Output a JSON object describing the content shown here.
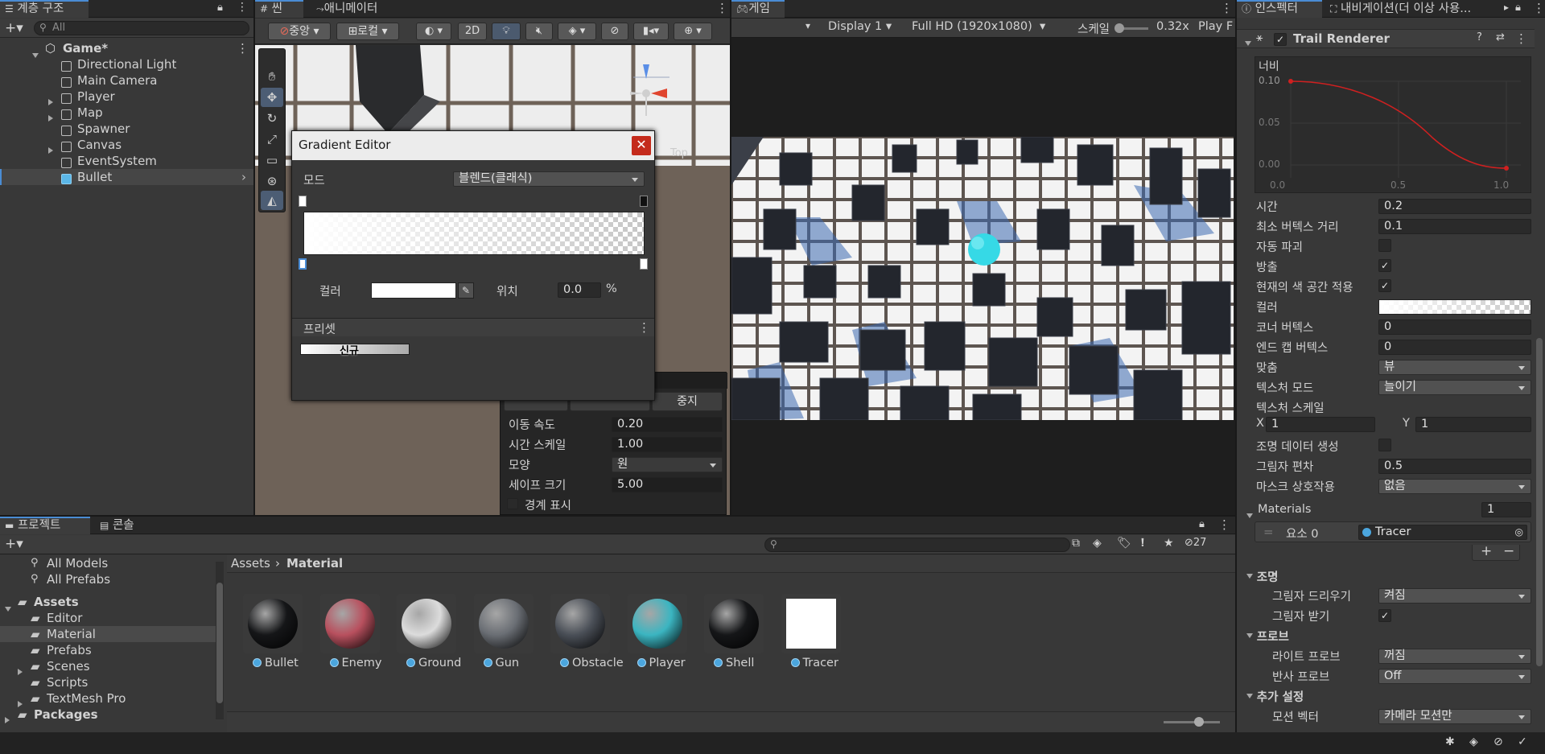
{
  "hierarchy": {
    "tab": "계층 구조",
    "search_placeholder": "All",
    "scene": "Game*",
    "items": [
      "Directional Light",
      "Main Camera",
      "Player",
      "Map",
      "Spawner",
      "Canvas",
      "EventSystem",
      "Bullet"
    ]
  },
  "scene_tabs": {
    "scene": "씬",
    "animator": "애니메이터",
    "pivot": "중앙",
    "space": "로컬",
    "mode2d": "2D",
    "gizmo_top": "Top"
  },
  "game_view": {
    "tab": "게임",
    "display": "Display 1",
    "resolution": "Full HD (1920x1080)",
    "scale_label": "스케일",
    "scale_value": "0.32x",
    "play": "Play F"
  },
  "gradient_editor": {
    "title": "Gradient Editor",
    "mode_label": "모드",
    "mode_value": "블렌드(클래식)",
    "color_label": "컬러",
    "location_label": "위치",
    "location_value": "0.0",
    "percent": "%",
    "presets_label": "프리셋",
    "new_label": "신규"
  },
  "overlay": {
    "stop": "중지",
    "rows": [
      {
        "label": "이동 속도",
        "value": "0.20"
      },
      {
        "label": "시간 스케일",
        "value": "1.00"
      },
      {
        "label": "모양",
        "value": "원"
      },
      {
        "label": "세이프 크기",
        "value": "5.00"
      }
    ],
    "bounds": "경계 표시"
  },
  "inspector": {
    "tab1": "인스펙터",
    "tab2": "내비게이션(더 이상 사용...",
    "component": "Trail Renderer",
    "curve": {
      "label": "너비",
      "y_labels": [
        "0.10",
        "0.05",
        "0.00"
      ],
      "x_labels": [
        "0.0",
        "0.5",
        "1.0"
      ]
    },
    "props": [
      {
        "label": "시간",
        "type": "field",
        "value": "0.2"
      },
      {
        "label": "최소 버텍스 거리",
        "type": "field",
        "value": "0.1"
      },
      {
        "label": "자동 파괴",
        "type": "check",
        "value": ""
      },
      {
        "label": "방출",
        "type": "check",
        "value": "✓"
      },
      {
        "label": "현재의 색 공간 적용",
        "type": "check",
        "value": "✓"
      },
      {
        "label": "컬러",
        "type": "gradient",
        "value": ""
      },
      {
        "label": "코너 버텍스",
        "type": "field",
        "value": "0"
      },
      {
        "label": "엔드 캡 버텍스",
        "type": "field",
        "value": "0"
      },
      {
        "label": "맞춤",
        "type": "drop",
        "value": "뷰"
      },
      {
        "label": "텍스처 모드",
        "type": "drop",
        "value": "늘이기"
      },
      {
        "label": "텍스처 스케일",
        "type": "none",
        "value": ""
      }
    ],
    "tex_x": "1",
    "tex_y": "1",
    "props2": [
      {
        "label": "조명 데이터 생성",
        "type": "check",
        "value": ""
      },
      {
        "label": "그림자 편차",
        "type": "field",
        "value": "0.5"
      },
      {
        "label": "마스크 상호작용",
        "type": "drop",
        "value": "없음"
      }
    ],
    "materials_label": "Materials",
    "materials_count": "1",
    "element_label": "요소 0",
    "element_value": "Tracer",
    "lighting_header": "조명",
    "cast_shadows": "그림자 드리우기",
    "cast_value": "켜짐",
    "receive_shadows": "그림자 받기",
    "probes_header": "프로브",
    "light_probes": "라이트 프로브",
    "light_value": "꺼짐",
    "reflection_probes": "반사 프로브",
    "reflection_value": "Off",
    "extra_header": "추가 설정",
    "motion_vectors": "모션 벡터",
    "motion_value": "카메라 모션만"
  },
  "project": {
    "tab": "프로젝트",
    "console": "콘솔",
    "count": "27",
    "favorites": [
      "All Models",
      "All Prefabs"
    ],
    "assets": "Assets",
    "folders": [
      "Editor",
      "Material",
      "Prefabs",
      "Scenes",
      "Scripts",
      "TextMesh Pro"
    ],
    "packages": "Packages",
    "breadcrumb_root": "Assets",
    "breadcrumb_current": "Material",
    "materials": [
      {
        "name": "Bullet",
        "color": "#151618"
      },
      {
        "name": "Enemy",
        "color": "#b8505e"
      },
      {
        "name": "Ground",
        "color": "#dcdcdc"
      },
      {
        "name": "Gun",
        "color": "#6a6e74"
      },
      {
        "name": "Obstacle",
        "color": "#4a4f57"
      },
      {
        "name": "Player",
        "color": "#3bb5c1"
      },
      {
        "name": "Shell",
        "color": "#151618"
      },
      {
        "name": "Tracer",
        "color": "#ffffff"
      }
    ]
  }
}
